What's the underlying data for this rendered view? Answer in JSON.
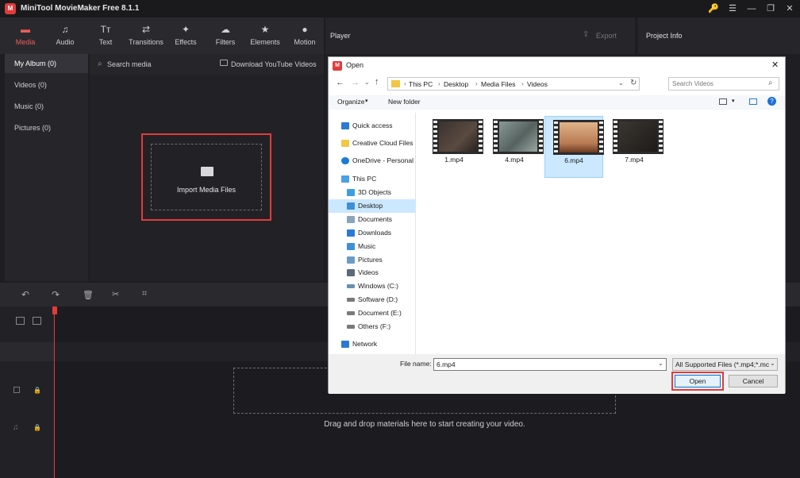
{
  "app": {
    "title": "MiniTool MovieMaker Free 8.1.1",
    "logo_glyph": "M",
    "window_buttons": [
      "🔑",
      "☰",
      "—",
      "❐",
      "✕"
    ]
  },
  "toolbar": {
    "tabs": [
      {
        "label": "Media",
        "icon": "▬",
        "active": true
      },
      {
        "label": "Audio",
        "icon": "♫"
      },
      {
        "label": "Text",
        "icon": "Tт"
      },
      {
        "label": "Transitions",
        "icon": "⇄"
      },
      {
        "label": "Effects",
        "icon": "✦"
      },
      {
        "label": "Filters",
        "icon": "☁"
      },
      {
        "label": "Elements",
        "icon": "★"
      },
      {
        "label": "Motion",
        "icon": "●"
      }
    ]
  },
  "media": {
    "sidebar": [
      "My Album (0)",
      "Videos (0)",
      "Music (0)",
      "Pictures (0)"
    ],
    "search_label": "Search media",
    "download_label": "Download YouTube Videos",
    "import_label": "Import Media Files"
  },
  "player": {
    "title": "Player",
    "export_label": "Export"
  },
  "project": {
    "title": "Project Info"
  },
  "timeline": {
    "drop_text": "Drag and drop materials here to start creating your video."
  },
  "dialog": {
    "title": "Open",
    "breadcrumb": [
      "This PC",
      "Desktop",
      "Media Files",
      "Videos"
    ],
    "search_placeholder": "Search Videos",
    "organize_label": "Organize",
    "new_folder_label": "New folder",
    "nav": [
      {
        "label": "Quick access",
        "color": "#2a7ad5"
      },
      {
        "label": "Creative Cloud Files",
        "color": "#f2c744"
      },
      {
        "label": "OneDrive - Personal",
        "color": "#1d7bd6"
      },
      {
        "label": "This PC",
        "color": "#4aa0e6"
      },
      {
        "label": "3D Objects",
        "color": "#3aa0e0"
      },
      {
        "label": "Desktop",
        "color": "#3c8fd8",
        "selected": true
      },
      {
        "label": "Documents",
        "color": "#8aa4bc"
      },
      {
        "label": "Downloads",
        "color": "#2a7ad5"
      },
      {
        "label": "Music",
        "color": "#3c8fd8"
      },
      {
        "label": "Pictures",
        "color": "#6d9bc6"
      },
      {
        "label": "Videos",
        "color": "#5a6a7a"
      },
      {
        "label": "Windows (C:)",
        "color": "#6a8fb0"
      },
      {
        "label": "Software (D:)",
        "color": "#7a7a7a"
      },
      {
        "label": "Document (E:)",
        "color": "#7a7a7a"
      },
      {
        "label": "Others (F:)",
        "color": "#7a7a7a"
      },
      {
        "label": "Network",
        "color": "#2a7ad5"
      }
    ],
    "files": [
      {
        "name": "1.mp4",
        "tint": "#5a4a40"
      },
      {
        "name": "4.mp4",
        "tint": "#7a8a86"
      },
      {
        "name": "6.mp4",
        "tint": "#c8946a",
        "selected": true
      },
      {
        "name": "7.mp4",
        "tint": "#2a2622"
      }
    ],
    "file_name_label": "File name:",
    "file_name_value": "6.mp4",
    "file_type_value": "All Supported Files (*.mp4;*.mc",
    "open_label": "Open",
    "cancel_label": "Cancel"
  }
}
